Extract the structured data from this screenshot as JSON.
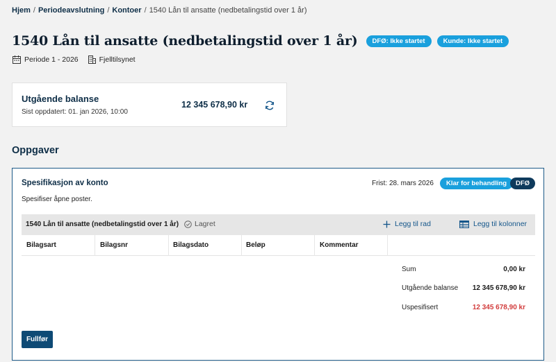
{
  "breadcrumb": {
    "items": [
      "Hjem",
      "Periodeavslutning",
      "Kontoer"
    ],
    "current": "1540 Lån til ansatte (nedbetalingstid over 1 år)",
    "separator": "/"
  },
  "header": {
    "title": "1540 Lån til ansatte (nedbetalingstid over 1 år)",
    "badges": [
      "DFØ: Ikke startet",
      "Kunde: Ikke startet"
    ],
    "period": "Periode 1 - 2026",
    "organization": "Fjelltilsynet"
  },
  "balance": {
    "title": "Utgående balanse",
    "updated": "Sist oppdatert: 01. jan 2026, 10:00",
    "amount": "12 345 678,90 kr"
  },
  "tasks_section": {
    "title": "Oppgaver"
  },
  "task": {
    "title": "Spesifikasjon av konto",
    "description": "Spesifiser åpne poster.",
    "deadline": "Frist: 28. mars 2026",
    "status": "Klar for behandling",
    "owner": "DFØ",
    "table": {
      "name": "1540 Lån til ansatte (nedbetalingstid over 1 år)",
      "saved": "Lagret",
      "add_row": "Legg til rad",
      "add_columns": "Legg til kolonner",
      "columns": [
        "Bilagsart",
        "Bilagsnr",
        "Bilagsdato",
        "Beløp",
        "Kommentar"
      ]
    },
    "summary": {
      "sum_label": "Sum",
      "sum_value": "0,00 kr",
      "closing_label": "Utgående balanse",
      "closing_value": "12 345 678,90 kr",
      "unspecified_label": "Uspesifisert",
      "unspecified_value": "12 345 678,90 kr"
    },
    "finish_button": "Fullfør"
  },
  "colors": {
    "accent_blue": "#1aa0dd",
    "navy": "#0e2e47",
    "primary_button": "#0e4a75",
    "negative": "#d23c3c",
    "link": "#14568a"
  },
  "icons": {
    "period": "calendar-icon",
    "organization": "building-icon",
    "refresh": "refresh-icon",
    "saved": "check-circle-icon",
    "add_row": "plus-icon",
    "add_columns": "table-columns-icon"
  }
}
